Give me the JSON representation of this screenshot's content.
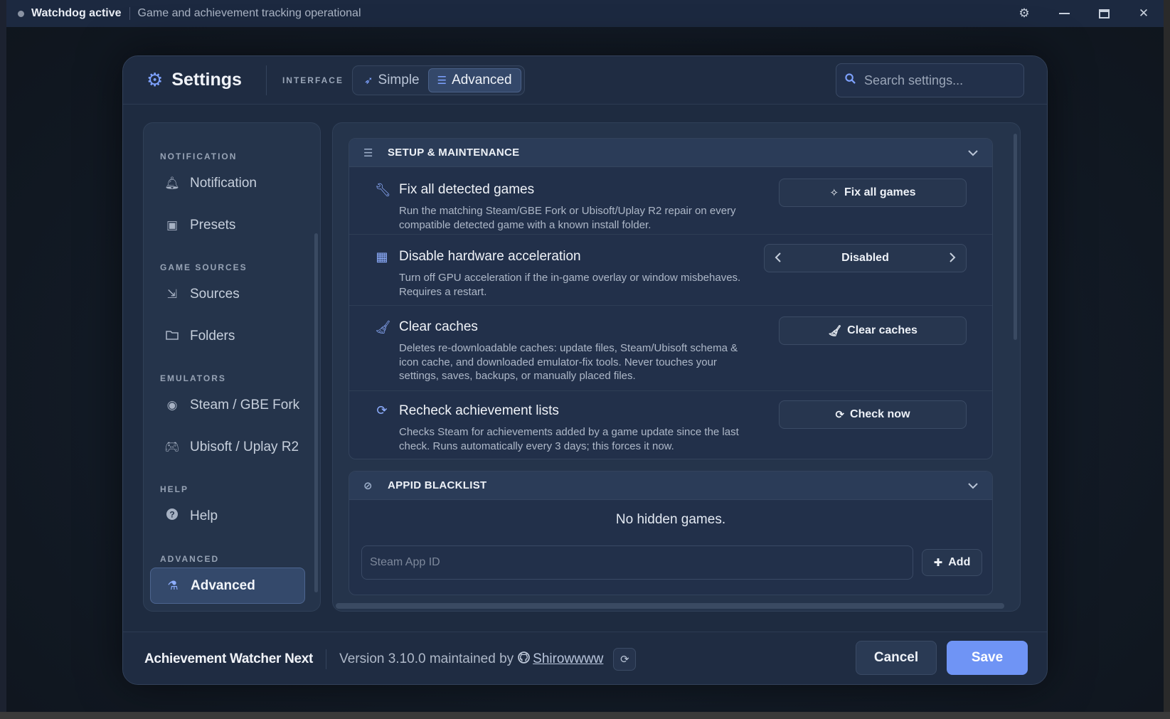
{
  "titlebar": {
    "watchdog": "Watchdog active",
    "status": "Game and achievement tracking operational",
    "icons": {
      "settings": "gear-icon",
      "minimize": "minimize-icon",
      "maximize": "maximize-icon",
      "close": "close-icon"
    }
  },
  "header": {
    "title": "Settings",
    "interface_label": "INTERFACE",
    "modes": [
      {
        "label": "Simple",
        "icon": "feather-icon",
        "active": false
      },
      {
        "label": "Advanced",
        "icon": "sliders-icon",
        "active": true
      }
    ],
    "search_placeholder": "Search settings..."
  },
  "sidebar": {
    "sections": [
      {
        "label": "NOTIFICATION"
      },
      {
        "label": "GAME SOURCES"
      },
      {
        "label": "EMULATORS"
      },
      {
        "label": "HELP"
      },
      {
        "label": "ADVANCED"
      }
    ],
    "items": [
      {
        "label": "Notification",
        "icon": "bell-icon"
      },
      {
        "label": "Presets",
        "icon": "toolbox-icon"
      },
      {
        "label": "Sources",
        "icon": "import-icon"
      },
      {
        "label": "Folders",
        "icon": "folder-icon"
      },
      {
        "label": "Steam / GBE Fork",
        "icon": "steam-icon"
      },
      {
        "label": "Ubisoft / Uplay R2",
        "icon": "gamepad-icon"
      },
      {
        "label": "Help",
        "icon": "question-icon"
      },
      {
        "label": "Advanced",
        "icon": "flask-icon",
        "active": true
      }
    ]
  },
  "setup": {
    "title": "SETUP & MAINTENANCE",
    "rows": [
      {
        "title": "Fix all detected games",
        "desc": "Run the matching Steam/GBE Fork or Ubisoft/Uplay R2 repair on every compatible detected game with a known install folder.",
        "button": "Fix all games",
        "icon": "wrench-icon"
      },
      {
        "title": "Disable hardware acceleration",
        "desc": "Turn off GPU acceleration if the in-game overlay or window misbehaves. Requires a restart.",
        "value": "Disabled",
        "icon": "chip-icon"
      },
      {
        "title": "Clear caches",
        "desc": "Deletes re-downloadable caches: update files, Steam/Ubisoft schema & icon cache, and downloaded emulator-fix tools. Never touches your settings, saves, backups, or manually placed files.",
        "button": "Clear caches",
        "icon": "broom-icon"
      },
      {
        "title": "Recheck achievement lists",
        "desc": "Checks Steam for achievements added by a game update since the last check. Runs automatically every 3 days; this forces it now.",
        "button": "Check now",
        "icon": "refresh-icon"
      }
    ]
  },
  "blacklist": {
    "title": "APPID BLACKLIST",
    "empty": "No hidden games.",
    "input_placeholder": "Steam App ID",
    "add_label": "Add"
  },
  "footer": {
    "app_name": "Achievement Watcher Next",
    "version": "Version 3.10.0 maintained by",
    "author": "Shirowwww",
    "cancel": "Cancel",
    "save": "Save"
  },
  "colors": {
    "accent": "#6f94f5",
    "icon_accent": "#7ea2ff",
    "background": "#121a25",
    "panel": "#25344b"
  }
}
